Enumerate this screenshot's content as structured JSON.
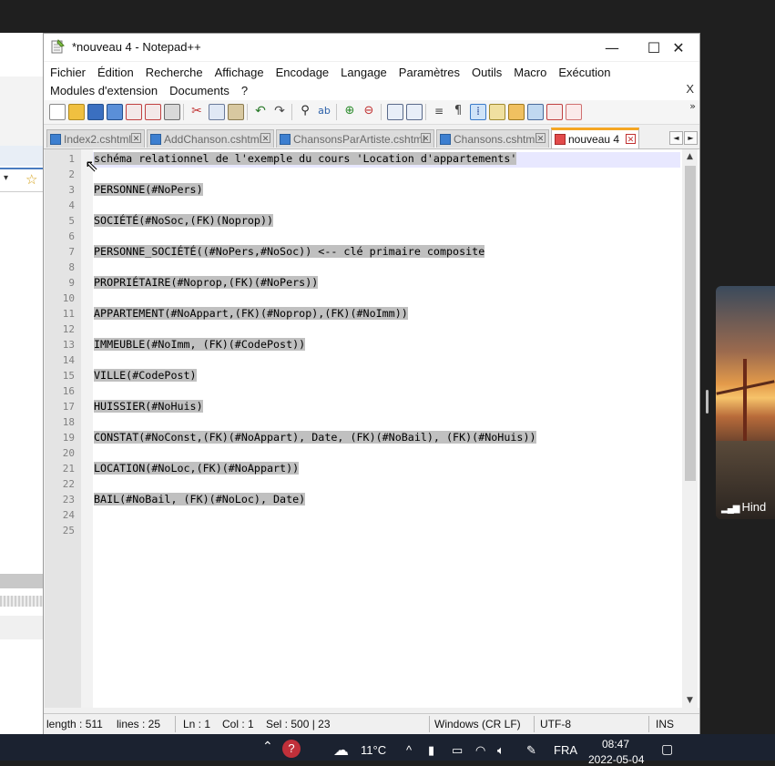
{
  "window": {
    "title": "*nouveau 4 - Notepad++",
    "minimize": "—",
    "maximize": "☐",
    "close": "✕"
  },
  "menu": {
    "row1": [
      "Fichier",
      "Édition",
      "Recherche",
      "Affichage",
      "Encodage",
      "Langage",
      "Paramètres",
      "Outils",
      "Macro",
      "Exécution"
    ],
    "row2": [
      "Modules d'extension",
      "Documents",
      "?"
    ],
    "close_label": "X"
  },
  "toolbar": {
    "more": "»"
  },
  "tabs": [
    {
      "label": "Index2.cshtml",
      "active": false
    },
    {
      "label": "AddChanson.cshtml",
      "active": false
    },
    {
      "label": "ChansonsParArtiste.cshtml",
      "active": false
    },
    {
      "label": "Chansons.cshtml",
      "active": false
    },
    {
      "label": "nouveau 4",
      "active": true
    }
  ],
  "tab_nav": {
    "left": "◄",
    "right": "►"
  },
  "editor": {
    "lines": [
      "schéma relationnel de l'exemple du cours 'Location d'appartements'",
      "",
      "PERSONNE(#NoPers)",
      "",
      "SOCIÉTÉ(#NoSoc,(FK)(Noprop))",
      "",
      "PERSONNE_SOCIÉTÉ((#NoPers,#NoSoc)) <-- clé primaire composite",
      "",
      "PROPRIÉTAIRE(#Noprop,(FK)(#NoPers))",
      "",
      "APPARTEMENT(#NoAppart,(FK)(#Noprop),(FK)(#NoImm))",
      "",
      "IMMEUBLE(#NoImm, (FK)(#CodePost))",
      "",
      "VILLE(#CodePost)",
      "",
      "HUISSIER(#NoHuis)",
      "",
      "CONSTAT(#NoConst,(FK)(#NoAppart), Date, (FK)(#NoBail), (FK)(#NoHuis))",
      "",
      "LOCATION(#NoLoc,(FK)(#NoAppart))",
      "",
      "BAIL(#NoBail, (FK)(#NoLoc), Date)",
      "",
      ""
    ],
    "line_numbers": [
      "1",
      "2",
      "3",
      "4",
      "5",
      "6",
      "7",
      "8",
      "9",
      "10",
      "11",
      "12",
      "13",
      "14",
      "15",
      "16",
      "17",
      "18",
      "19",
      "20",
      "21",
      "22",
      "23",
      "24",
      "25"
    ]
  },
  "status": {
    "length": "length : 511",
    "lines": "lines : 25",
    "ln": "Ln : 1",
    "col": "Col : 1",
    "sel": "Sel : 500 | 23",
    "eol": "Windows (CR LF)",
    "encoding": "UTF-8",
    "mode": "INS"
  },
  "video": {
    "name": "Hind"
  },
  "taskbar": {
    "temp": "11°C",
    "lang": "FRA",
    "time": "08:47",
    "date": "2022-05-04"
  },
  "colors": {
    "selection": "#c0c0c0",
    "active_tab_accent": "#f5a623",
    "gutter": "#e4e4e4",
    "taskbar": "#1b2230"
  }
}
